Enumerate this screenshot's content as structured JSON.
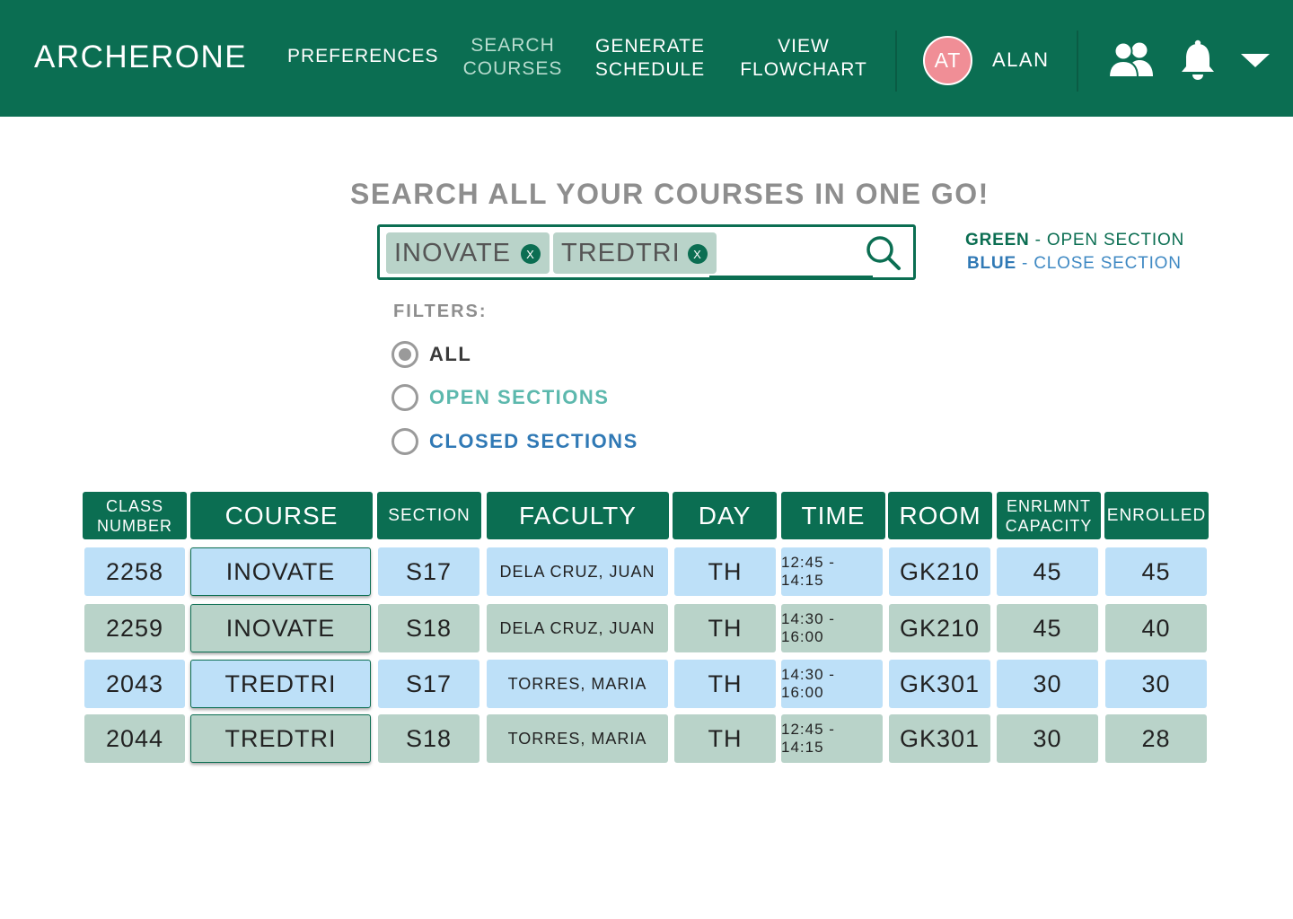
{
  "app": {
    "logo": "ARCHERONE"
  },
  "nav": {
    "preferences": "PREFERENCES",
    "search_line1": "SEARCH",
    "search_line2": "COURSES",
    "generate_line1": "GENERATE",
    "generate_line2": "SCHEDULE",
    "flowchart_line1": "VIEW",
    "flowchart_line2": "FLOWCHART",
    "active": "SEARCH COURSES"
  },
  "user": {
    "initials": "AT",
    "name": "ALAN",
    "avatar_color": "#f08e96"
  },
  "icons": [
    "friends-icon",
    "bell-icon",
    "chevron-down-icon",
    "search-icon",
    "close-icon"
  ],
  "search": {
    "headline": "SEARCH ALL YOUR COURSES IN ONE GO!",
    "chips": [
      {
        "label": "INOVATE",
        "remove": "X"
      },
      {
        "label": "TREDTRI",
        "remove": "X"
      }
    ]
  },
  "legend": {
    "green_key": "GREEN",
    "green_text": "- OPEN SECTION",
    "blue_key": "BLUE",
    "blue_text": "- CLOSE SECTION"
  },
  "filters": {
    "label": "FILTERS:",
    "options": [
      "ALL",
      "OPEN SECTIONS",
      "CLOSED SECTIONS"
    ],
    "selected": "ALL"
  },
  "colors": {
    "brand": "#0b6e52",
    "open_row": "#b9d3c9",
    "closed_row": "#bde0f8",
    "open_label": "#5cb8ad",
    "closed_label": "#3079b5"
  },
  "table": {
    "headers": {
      "class_number_1": "CLASS",
      "class_number_2": "NUMBER",
      "course": "COURSE",
      "section": "SECTION",
      "faculty": "FACULTY",
      "day": "DAY",
      "time": "TIME",
      "room": "ROOM",
      "capacity_1": "ENRLMNT",
      "capacity_2": "CAPACITY",
      "enrolled": "ENROLLED"
    },
    "rows": [
      {
        "class_number": "2258",
        "course": "INOVATE",
        "section": "S17",
        "faculty": "DELA CRUZ, JUAN",
        "day": "TH",
        "time": "12:45 - 14:15",
        "room": "GK210",
        "capacity": "45",
        "enrolled": "45",
        "status": "closed"
      },
      {
        "class_number": "2259",
        "course": "INOVATE",
        "section": "S18",
        "faculty": "DELA CRUZ, JUAN",
        "day": "TH",
        "time": "14:30 - 16:00",
        "room": "GK210",
        "capacity": "45",
        "enrolled": "40",
        "status": "open"
      },
      {
        "class_number": "2043",
        "course": "TREDTRI",
        "section": "S17",
        "faculty": "TORRES, MARIA",
        "day": "TH",
        "time": "14:30 - 16:00",
        "room": "GK301",
        "capacity": "30",
        "enrolled": "30",
        "status": "closed"
      },
      {
        "class_number": "2044",
        "course": "TREDTRI",
        "section": "S18",
        "faculty": "TORRES, MARIA",
        "day": "TH",
        "time": "12:45 - 14:15",
        "room": "GK301",
        "capacity": "30",
        "enrolled": "28",
        "status": "open"
      }
    ]
  }
}
